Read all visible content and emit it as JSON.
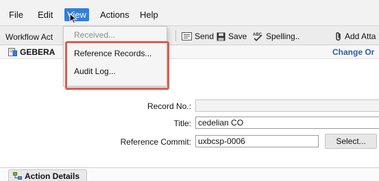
{
  "menubar": {
    "items": [
      {
        "label": "File"
      },
      {
        "label": "Edit"
      },
      {
        "label": "View"
      },
      {
        "label": "Actions"
      },
      {
        "label": "Help"
      }
    ]
  },
  "toolbar": {
    "workflow_label": "Workflow Act",
    "buttons": [
      {
        "label": "Send",
        "icon": "send-icon"
      },
      {
        "label": "Save",
        "icon": "save-icon"
      },
      {
        "label": "Spelling..",
        "icon": "spelling-icon"
      },
      {
        "label": "Add Atta",
        "icon": "paperclip-icon"
      }
    ]
  },
  "subheader": {
    "title": "GEBERA",
    "change_link": "Change Or"
  },
  "view_menu": {
    "items": [
      {
        "label": "Received...",
        "enabled": false
      },
      {
        "label": "Reference Records...",
        "enabled": true
      },
      {
        "label": "Audit Log...",
        "enabled": true
      }
    ],
    "highlight_color": "#e05a4f"
  },
  "form": {
    "record_no_label": "Record No.:",
    "record_no_value": "",
    "title_label": "Title:",
    "title_value": "cedelian CO",
    "reference_commit_label": "Reference Commit:",
    "reference_commit_value": "uxbcsp-0006",
    "select_button": "Select..."
  },
  "tabs": {
    "action_details": "Action Details"
  }
}
